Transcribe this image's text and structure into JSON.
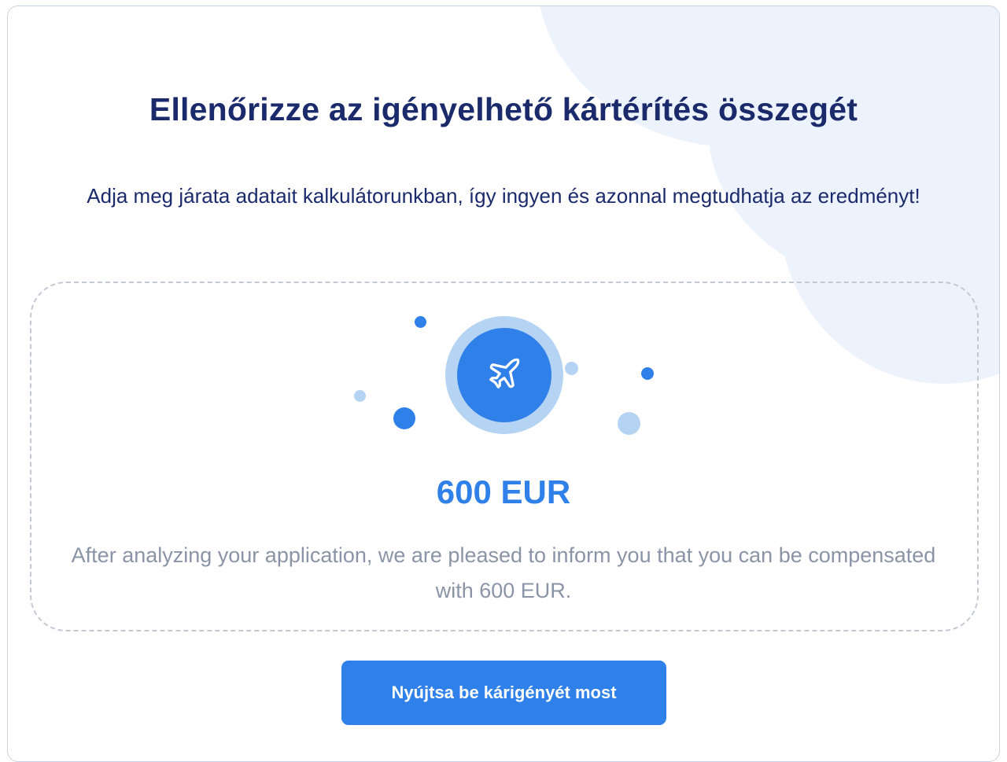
{
  "heading": "Ellenőrizze az igényelhető kártérítés összegét",
  "subheading": "Adja meg járata adatait kalkulátorunkban, így ingyen és azonnal megtudhatja az eredményt!",
  "result": {
    "amount": "600 EUR",
    "message": "After analyzing your application, we are pleased to inform you that you can be compensated with 600 EUR.",
    "icon": "airplane-icon"
  },
  "cta": {
    "label": "Nyújtsa be kárigényét most"
  },
  "colors": {
    "primary": "#2f80e8",
    "heading": "#1b2a6b",
    "muted": "#8a94a6",
    "accent_light": "#b5d3f3",
    "background_shape": "#edf3fd"
  }
}
